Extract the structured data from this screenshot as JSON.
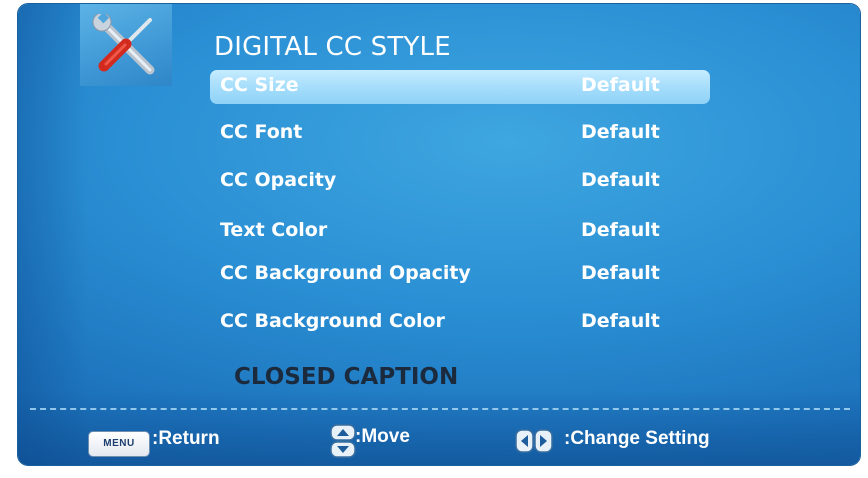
{
  "menu": {
    "title": "DIGITAL CC STYLE",
    "items": [
      {
        "label": "CC Size",
        "value": "Default",
        "selected": true
      },
      {
        "label": "CC Font",
        "value": "Default",
        "selected": false
      },
      {
        "label": "CC Opacity",
        "value": "Default",
        "selected": false
      },
      {
        "label": "Text Color",
        "value": "Default",
        "selected": false
      },
      {
        "label": "CC Background Opacity",
        "value": "Default",
        "selected": false
      },
      {
        "label": "CC Background Color",
        "value": "Default",
        "selected": false
      }
    ],
    "section_heading": "CLOSED CAPTION",
    "icon": "tools-icon"
  },
  "footer": {
    "menu_key_label": "MENU",
    "return_label": ":Return",
    "move_label": ":Move",
    "change_label": ":Change Setting"
  },
  "colors": {
    "background": "#2a8fd4",
    "highlight": "#a3dcfb",
    "heading_text": "#1c2a3e"
  }
}
